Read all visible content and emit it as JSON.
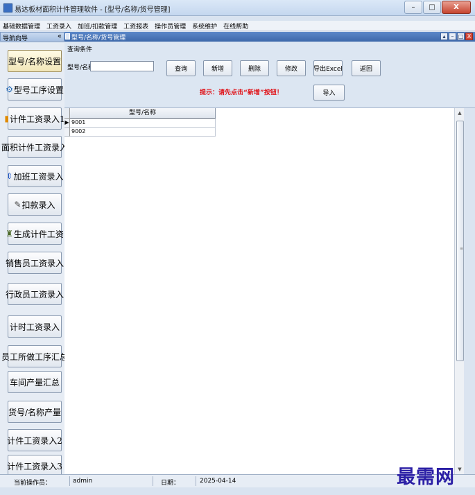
{
  "window": {
    "title": "易达板材面积计件管理软件 - [型号/名称/货号管理]",
    "buttons": {
      "minimize": "–",
      "maximize": "□",
      "close": "X"
    }
  },
  "menu": [
    "基础数据管理",
    "工资录入",
    "加班/扣款管理",
    "工资报表",
    "操作员管理",
    "系统维护",
    "在线帮助"
  ],
  "nav": {
    "header": "导航向导",
    "collapse": "«",
    "items": [
      {
        "label": "型号/名称设置",
        "icon": ""
      },
      {
        "label": "型号工序设置",
        "icon": "⚙"
      },
      {
        "label": "计件工资录入1",
        "icon": "▮"
      },
      {
        "label": "面积计件工资录入",
        "icon": ""
      },
      {
        "label": "加班工资录入",
        "icon": "⇕"
      },
      {
        "label": "扣款录入",
        "icon": "✎"
      },
      {
        "label": "生成计件工资",
        "icon": "♜"
      },
      {
        "label": "销售员工资录入",
        "icon": ""
      },
      {
        "label": "行政员工资录入",
        "icon": ""
      },
      {
        "label": "计时工资录入",
        "icon": ""
      },
      {
        "label": "员工所做工序汇总",
        "icon": ""
      },
      {
        "label": "车间产量汇总",
        "icon": ""
      },
      {
        "label": "货号/名称产量",
        "icon": ""
      },
      {
        "label": "计件工资录入2",
        "icon": ""
      },
      {
        "label": "计件工资录入3",
        "icon": ""
      }
    ]
  },
  "child": {
    "title": "型号/名称/货号管理",
    "buttons": [
      "▴",
      "–",
      "□",
      "X"
    ]
  },
  "query": {
    "section_label": "查询条件",
    "field_label": "型号/名称",
    "field_value": "",
    "buttons": {
      "search": "查询",
      "add": "新增",
      "delete": "删除",
      "modify": "修改",
      "export": "导出Excel",
      "back": "返回",
      "import": "导入"
    },
    "hint": "提示：请先点击“新增”按钮！"
  },
  "grid": {
    "column": "型号/名称",
    "rows": [
      "9001",
      "9002"
    ],
    "current_row_marker": "▶"
  },
  "status": {
    "operator_label": "当前操作员：",
    "operator": "admin",
    "date_label": "日期：",
    "date": "2025-04-14"
  },
  "watermark": "最需网"
}
